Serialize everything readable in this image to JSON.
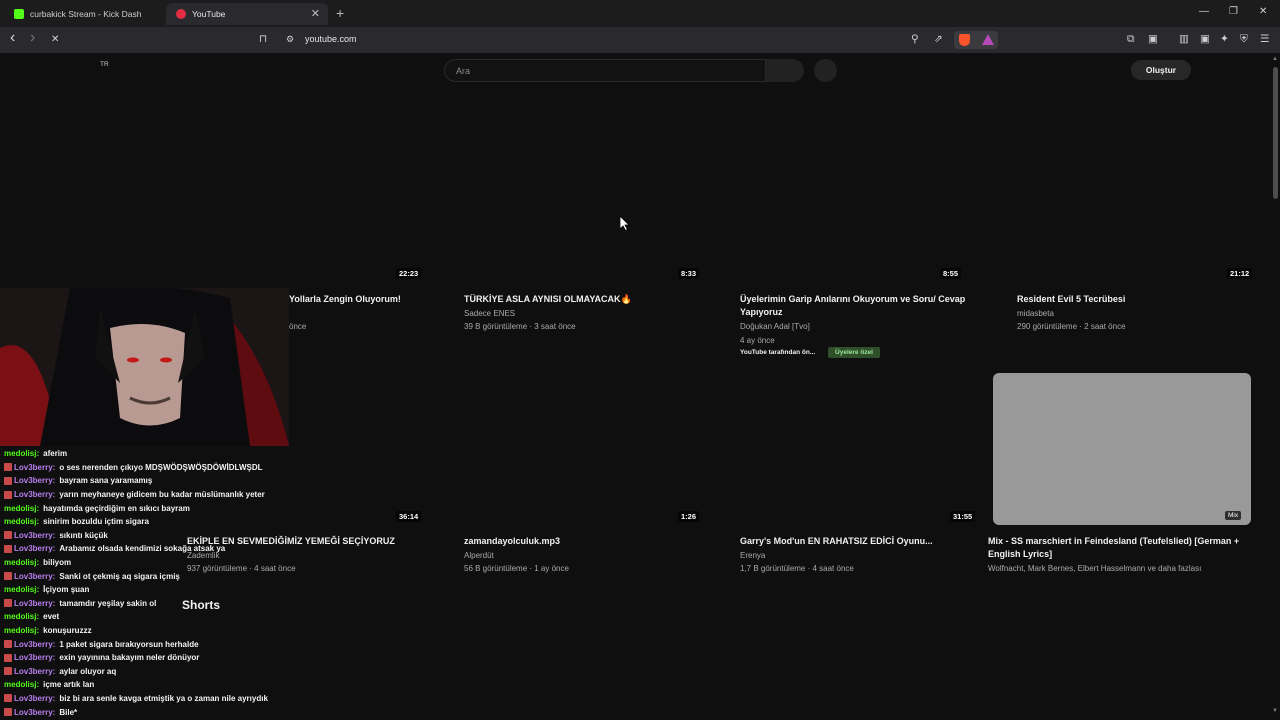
{
  "browser": {
    "tabs": [
      {
        "title": "curbakick Stream - Kick Dashboard",
        "active": false,
        "favicon_color": "#53fc18"
      },
      {
        "title": "YouTube",
        "active": true,
        "favicon_color": "#e22d43"
      }
    ],
    "new_tab": "+",
    "window_controls": {
      "minimize": "—",
      "restore": "❐",
      "close": "✕"
    },
    "tab_close": "✕",
    "url": "youtube.com",
    "icons": {
      "back": "‹",
      "forward": "›",
      "reload": "✕",
      "bookmark": "⊓",
      "site_info": "⚙",
      "zoom": "⚲",
      "share": "⇗",
      "extensions": "⧉",
      "wallet": "▣",
      "sidebar": "▥",
      "leo": "✦",
      "vpn": "⛨",
      "menu": "☰"
    }
  },
  "youtube": {
    "region": "TR",
    "search_placeholder": "Ara",
    "create_label": "Oluştur",
    "shorts_heading": "Shorts",
    "row1": [
      {
        "duration": "22:23",
        "title": "Yollarla Zengin Oluyorum!",
        "channel": "",
        "meta": "önce"
      },
      {
        "duration": "8:33",
        "title": "TÜRKİYE ASLA AYNISI OLMAYACAK🔥",
        "channel": "Sadece ENES",
        "meta": "39 B görüntüleme · 3 saat önce"
      },
      {
        "duration": "8:55",
        "title": "Üyelerimin Garip Anılarını Okuyorum ve Soru/ Cevap Yapıyoruz",
        "channel": "Doğukan Adal [Tvo]",
        "meta": "4 ay önce",
        "badges": [
          "YouTube tarafından ön...",
          "Üyelere özel"
        ]
      },
      {
        "duration": "21:12",
        "title": "Resident Evil 5 Tecrübesi",
        "channel": "midasbeta",
        "meta": "290 görüntüleme · 2 saat önce"
      }
    ],
    "row2": [
      {
        "duration": "36:14",
        "title": "EKİPLE EN SEVMEDİĞİMİZ YEMEĞİ SEÇİYORUZ",
        "channel": "Zademlik",
        "meta": "937 görüntüleme · 4 saat önce"
      },
      {
        "duration": "1:26",
        "title": "zamandayolculuk.mp3",
        "channel": "Alperdüt",
        "meta": "56 B görüntüleme · 1 ay önce"
      },
      {
        "duration": "31:55",
        "title": "Garry's Mod'un EN RAHATSIZ EDİCİ Oyunu...",
        "channel": "Erenya",
        "meta": "1,7 B görüntüleme · 4 saat önce"
      },
      {
        "duration": "Mix",
        "title": "Mix - SS marschiert in Feindesland (Teufelslied) [German + English Lyrics]",
        "channel": "Wolfnacht, Mark Bernes, Elbert Hasselmann ve daha fazlası",
        "meta": ""
      }
    ]
  },
  "chat": [
    {
      "user": "medolisj",
      "msg": "aferim",
      "badge": false
    },
    {
      "user": "Lov3berry",
      "msg": "o ses nerenden çıkıyo MDŞWÖDŞWÖŞDÖWİDLWŞDL",
      "badge": true
    },
    {
      "user": "Lov3berry",
      "msg": "bayram sana yaramamış",
      "badge": true
    },
    {
      "user": "Lov3berry",
      "msg": "yarın meyhaneye gidicem bu kadar müslümanlık yeter",
      "badge": true
    },
    {
      "user": "medolisj",
      "msg": "hayatımda geçirdiğim en sıkıcı bayram",
      "badge": false
    },
    {
      "user": "medolisj",
      "msg": "sinirim bozuldu içtim sigara",
      "badge": false
    },
    {
      "user": "Lov3berry",
      "msg": "sıkıntı küçük",
      "badge": true
    },
    {
      "user": "Lov3berry",
      "msg": "Arabamız olsada kendimizi sokağa atsak ya",
      "badge": true
    },
    {
      "user": "medolisj",
      "msg": "biliyom",
      "badge": false
    },
    {
      "user": "Lov3berry",
      "msg": "Sanki ot çekmiş aq sigara içmiş",
      "badge": true
    },
    {
      "user": "medolisj",
      "msg": "İçiyom şuan",
      "badge": false
    },
    {
      "user": "Lov3berry",
      "msg": "tamamdır yeşilay sakin ol",
      "badge": true
    },
    {
      "user": "medolisj",
      "msg": "evet",
      "badge": false
    },
    {
      "user": "medolisj",
      "msg": "konuşuruzzz",
      "badge": false
    },
    {
      "user": "Lov3berry",
      "msg": "1 paket sigara bırakıyorsun herhalde",
      "badge": true
    },
    {
      "user": "Lov3berry",
      "msg": "exin yayınına bakayım neler dönüyor",
      "badge": true
    },
    {
      "user": "Lov3berry",
      "msg": "aylar oluyor aq",
      "badge": true
    },
    {
      "user": "medolisj",
      "msg": "içme artık lan",
      "badge": false
    },
    {
      "user": "Lov3berry",
      "msg": "biz bi ara senle kavga etmiştik ya o zaman nile ayrıydık",
      "badge": true
    },
    {
      "user": "Lov3berry",
      "msg": "Bile*",
      "badge": true
    }
  ],
  "colors": {
    "green_user": "#53fc18",
    "purple_user": "#b97ff0",
    "badge_bg": "#2f4f2a",
    "badge_text": "#9be89b"
  }
}
